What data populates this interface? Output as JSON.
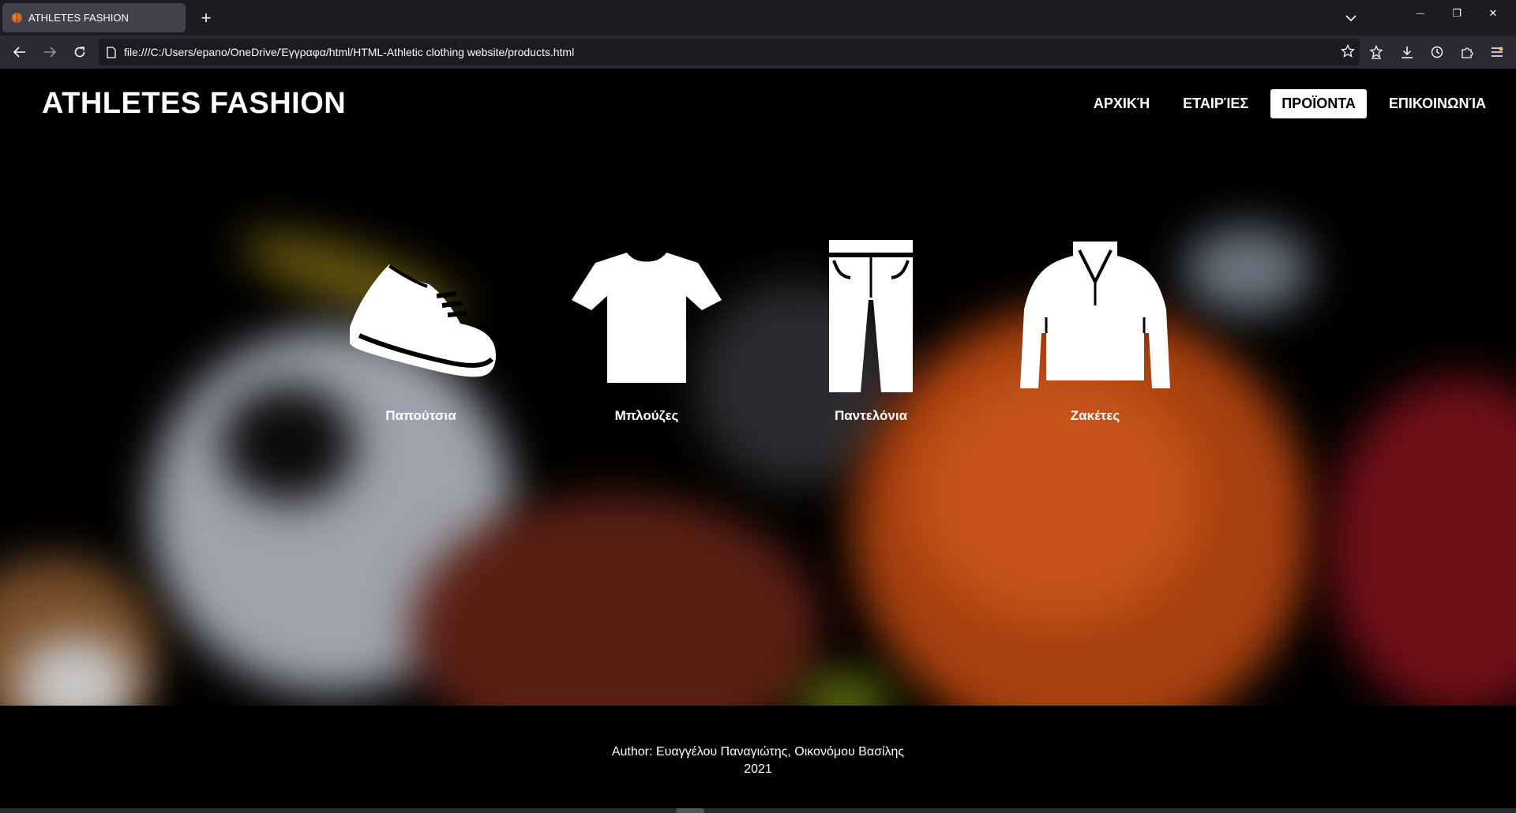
{
  "browser": {
    "tab_title": "ATHLETES FASHION",
    "new_tab_label": "+",
    "url": "file:///C:/Users/epano/OneDrive/Έγγραφα/html/HTML-Athletic clothing website/products.html",
    "window_controls": {
      "minimize": "—",
      "restore": "❐",
      "close": "✕"
    }
  },
  "site": {
    "title": "ATHLETES FASHION",
    "nav": [
      {
        "label": "ΑΡΧΙΚΉ",
        "active": false
      },
      {
        "label": "ΕΤΑΙΡΊΕΣ",
        "active": false
      },
      {
        "label": "ΠΡΟΪΟΝΤΑ",
        "active": true
      },
      {
        "label": "ΕΠΙΚΟΙΝΩΝΊΑ",
        "active": false
      }
    ]
  },
  "products": [
    {
      "label": "Παπούτσια",
      "icon": "shoe-icon"
    },
    {
      "label": "Μπλούζες",
      "icon": "tshirt-icon"
    },
    {
      "label": "Παντελόνια",
      "icon": "pants-icon"
    },
    {
      "label": "Ζακέτες",
      "icon": "jacket-icon"
    }
  ],
  "footer": {
    "author": "Author: Ευαγγέλου Παναγιώτης, Οικονόμου Βασίλης",
    "year": "2021"
  },
  "colors": {
    "chrome_dark": "#1c1b22",
    "chrome_toolbar": "#2b2a33",
    "active_tab": "#42414d",
    "page_bg": "#000000",
    "accent_white": "#ffffff"
  }
}
